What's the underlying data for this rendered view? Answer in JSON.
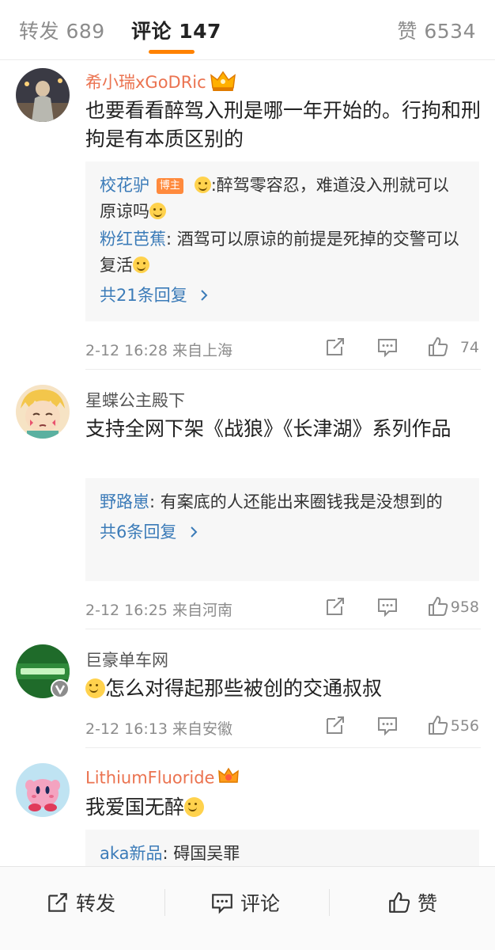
{
  "tabs": {
    "repost": "转发 689",
    "comment": "评论 147",
    "like": "赞 6534"
  },
  "colors": {
    "accent": "#ff8200",
    "username_vip": "#eb7350",
    "link": "#3b7bb8"
  },
  "comments": [
    {
      "user": "希小瑞xGoDRic",
      "text": "也要看看醉驾入刑是哪一年开始的。行拘和刑拘是有本质区别的",
      "replies": [
        {
          "user": "校花驴",
          "badge": "博主",
          "text": ":醉驾零容忍，难道没入刑就可以原谅吗"
        },
        {
          "user": "粉红芭蕉",
          "text": ": 酒驾可以原谅的前提是死掉的交警可以复活"
        }
      ],
      "more": "共21条回复",
      "time": "2-12 16:28  来自上海",
      "likes": "74"
    },
    {
      "user": "星蝶公主殿下",
      "text": "支持全网下架《战狼》《长津湖》系列作品",
      "replies": [
        {
          "user": "野路崽",
          "text": ": 有案底的人还能出来圈钱我是没想到的"
        }
      ],
      "more": "共6条回复",
      "time": "2-12 16:25  来自河南",
      "likes": "958"
    },
    {
      "user": "巨豪单车网",
      "text": "怎么对得起那些被创的交通叔叔",
      "time": "2-12 16:13  来自安徽",
      "likes": "556"
    },
    {
      "user": "LithiumFluoride",
      "text": "我爱国无醉",
      "replies": [
        {
          "user": "aka新品",
          "text": ": 碍国吴罪"
        }
      ]
    }
  ],
  "bottom": {
    "repost": "转发",
    "comment": "评论",
    "like": "赞"
  },
  "icons": [
    "share-icon",
    "reply-icon",
    "like-icon",
    "crown-badge-icon",
    "verified-badge-icon",
    "chevron-right-icon"
  ]
}
